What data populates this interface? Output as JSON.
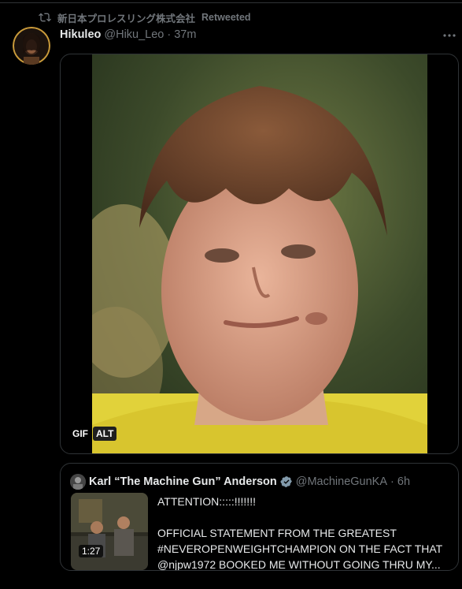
{
  "retweet": {
    "account_name": "新日本プロレスリング株式会社",
    "label": "Retweeted",
    "icon": "retweet-icon"
  },
  "tweet": {
    "display_name": "Hikuleo",
    "handle": "@Hiku_Leo",
    "separator": "·",
    "time": "37m",
    "more_icon": "more-icon"
  },
  "media": {
    "gif_label": "GIF",
    "alt_label": "ALT"
  },
  "quote": {
    "display_name": "Karl “The Machine Gun” Anderson",
    "handle": "@MachineGunKA",
    "separator": "·",
    "time": "6h",
    "verified_icon": "verified-icon",
    "video_duration": "1:27",
    "text_lines": [
      "ATTENTION:::::!!!!!!!",
      "",
      "OFFICIAL STATEMENT FROM THE GREATEST",
      "#NEVEROPENWEIGHTCHAMPION ON THE FACT THAT",
      "@njpw1972 BOOKED ME WITHOUT GOING THRU MY..."
    ]
  },
  "colors": {
    "background": "#000000",
    "text_primary": "#e7e9ea",
    "text_secondary": "#71767b",
    "border": "#2f3336",
    "verified": "#829aab"
  }
}
